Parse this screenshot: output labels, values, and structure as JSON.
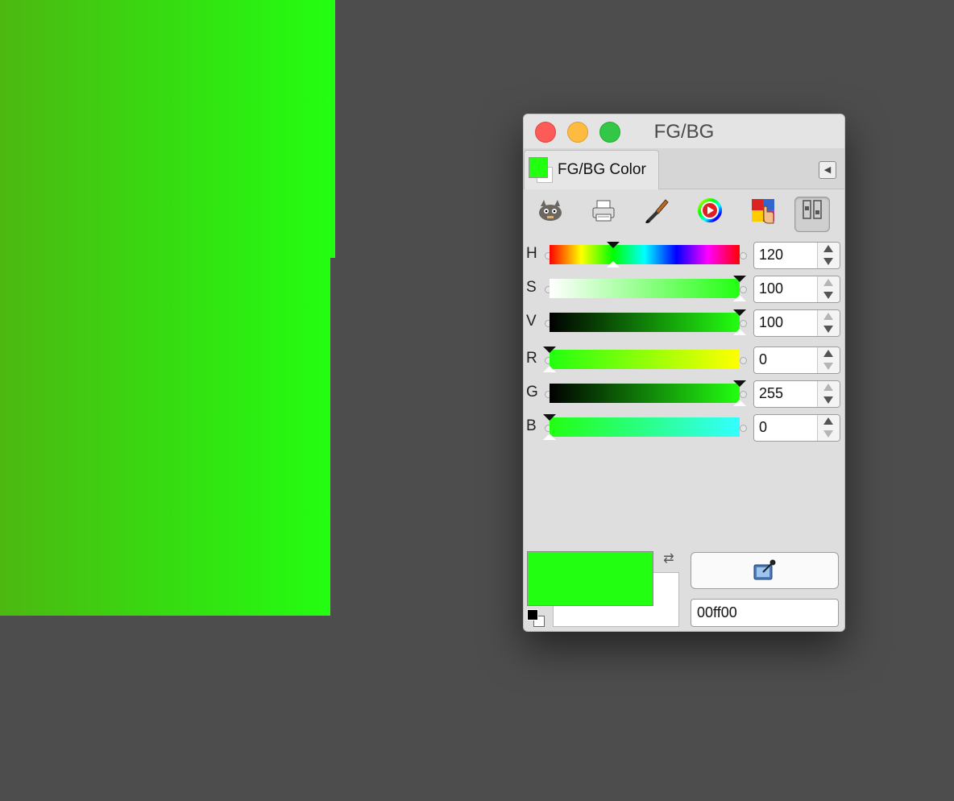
{
  "canvas": {
    "color_start": "#4cb811",
    "color_end": "#22ff11"
  },
  "window": {
    "title": "FG/BG",
    "tab_label": "FG/BG Color",
    "toolbar_icons": [
      "gimp-icon",
      "printer-icon",
      "brush-icon",
      "color-wheel-icon",
      "palette-picker-icon",
      "sliders-icon"
    ],
    "active_toolbar_icon": "sliders-icon"
  },
  "sliders": [
    {
      "letter": "H",
      "value": "120",
      "fraction": 0.333,
      "up_dim": false,
      "down_dim": false
    },
    {
      "letter": "S",
      "value": "100",
      "fraction": 1.0,
      "up_dim": true,
      "down_dim": false
    },
    {
      "letter": "V",
      "value": "100",
      "fraction": 1.0,
      "up_dim": true,
      "down_dim": false
    },
    {
      "letter": "R",
      "value": "0",
      "fraction": 0.0,
      "up_dim": false,
      "down_dim": true
    },
    {
      "letter": "G",
      "value": "255",
      "fraction": 1.0,
      "up_dim": true,
      "down_dim": false
    },
    {
      "letter": "B",
      "value": "0",
      "fraction": 0.0,
      "up_dim": false,
      "down_dim": true
    }
  ],
  "colors": {
    "foreground": "#00ff00",
    "background": "#ffffff",
    "hex": "00ff00"
  }
}
